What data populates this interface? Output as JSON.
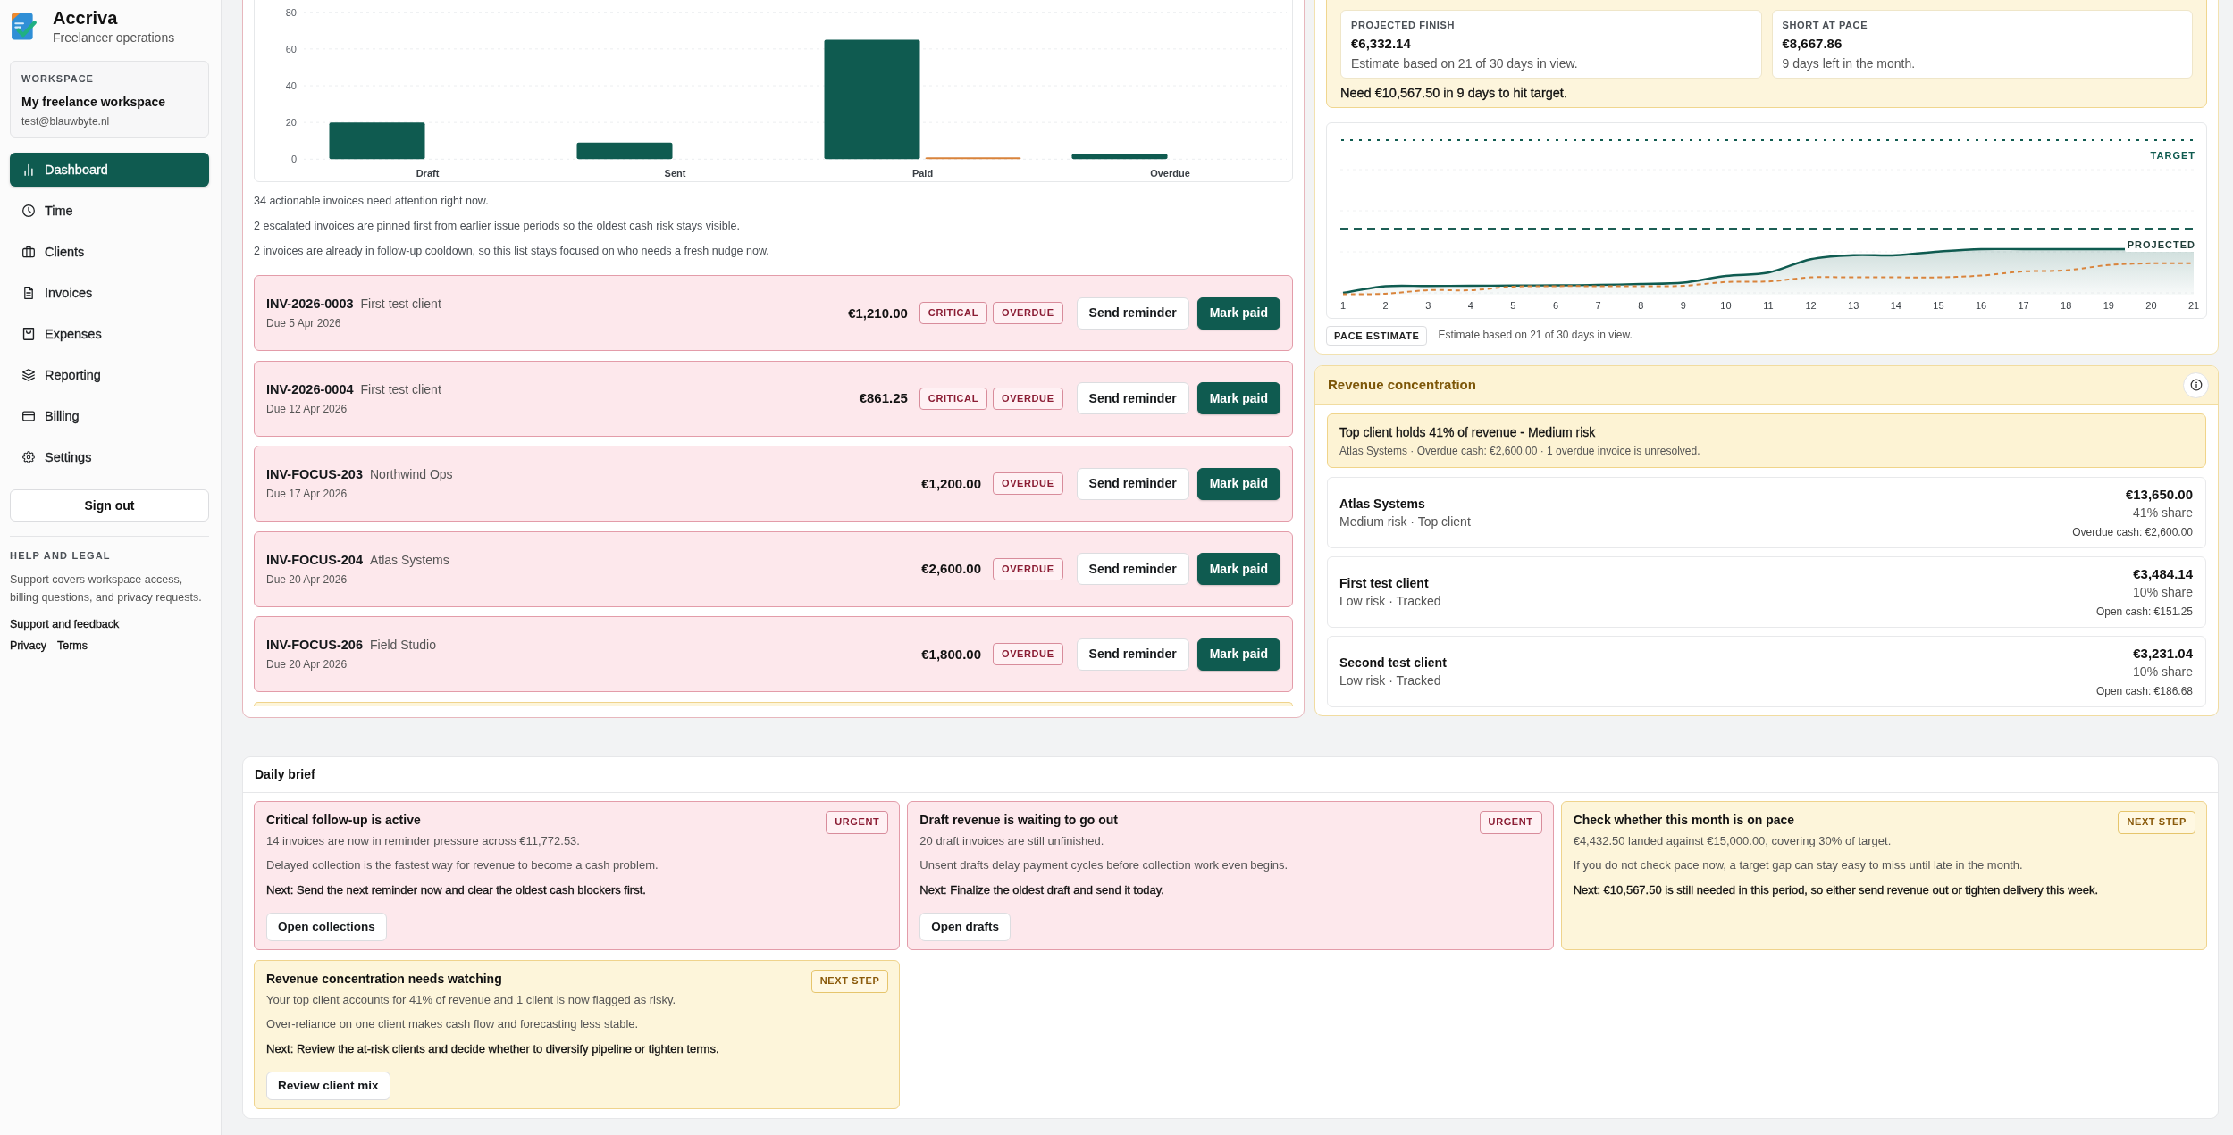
{
  "sidebar": {
    "brand": {
      "name": "Accriva",
      "tagline": "Freelancer operations"
    },
    "workspace": {
      "label": "WORKSPACE",
      "name": "My freelance workspace",
      "email": "test@blauwbyte.nl"
    },
    "nav": [
      {
        "label": "Dashboard",
        "selected": true
      },
      {
        "label": "Time",
        "selected": false
      },
      {
        "label": "Clients",
        "selected": false
      },
      {
        "label": "Invoices",
        "selected": false
      },
      {
        "label": "Expenses",
        "selected": false
      },
      {
        "label": "Reporting",
        "selected": false
      },
      {
        "label": "Billing",
        "selected": false
      },
      {
        "label": "Settings",
        "selected": false
      }
    ],
    "sign_out": "Sign out",
    "help": {
      "heading": "HELP AND LEGAL",
      "text": "Support covers workspace access, billing questions, and privacy requests.",
      "support_link": "Support and feedback",
      "legal_links": [
        "Privacy",
        "Terms"
      ]
    }
  },
  "invoice_panel": {
    "chart_data": {
      "type": "bar",
      "categories": [
        "Draft",
        "Sent",
        "Paid",
        "Overdue"
      ],
      "series": [
        {
          "color": "#0f5b50",
          "values": [
            20,
            9,
            65,
            3
          ]
        },
        {
          "color": "#d9843c",
          "values": [
            0,
            0,
            1,
            0
          ]
        }
      ],
      "ylim": [
        0,
        80
      ],
      "yticks": [
        0,
        20,
        40,
        60,
        80
      ],
      "grid": true
    },
    "notes": [
      "34 actionable invoices need attention right now.",
      "2 escalated invoices are pinned first from earlier issue periods so the oldest cash risk stays visible.",
      "2 invoices are already in follow-up cooldown, so this list stays focused on who needs a fresh nudge now."
    ],
    "invoices": [
      {
        "number": "INV-2026-0003",
        "client": "First test client",
        "due": "Due 5 Apr 2026",
        "amount": "€1,210.00",
        "badges": [
          "CRITICAL",
          "OVERDUE"
        ],
        "kind": "danger",
        "reminder_button": "Send reminder",
        "paid_button": "Mark paid"
      },
      {
        "number": "INV-2026-0004",
        "client": "First test client",
        "due": "Due 12 Apr 2026",
        "amount": "€861.25",
        "badges": [
          "CRITICAL",
          "OVERDUE"
        ],
        "kind": "danger",
        "reminder_button": "Send reminder",
        "paid_button": "Mark paid"
      },
      {
        "number": "INV-FOCUS-203",
        "client": "Northwind Ops",
        "due": "Due 17 Apr 2026",
        "amount": "€1,200.00",
        "badges": [
          "OVERDUE"
        ],
        "kind": "danger",
        "reminder_button": "Send reminder",
        "paid_button": "Mark paid"
      },
      {
        "number": "INV-FOCUS-204",
        "client": "Atlas Systems",
        "due": "Due 20 Apr 2026",
        "amount": "€2,600.00",
        "badges": [
          "OVERDUE"
        ],
        "kind": "danger",
        "reminder_button": "Send reminder",
        "paid_button": "Mark paid"
      },
      {
        "number": "INV-FOCUS-206",
        "client": "Field Studio",
        "due": "Due 20 Apr 2026",
        "amount": "€1,800.00",
        "badges": [
          "OVERDUE"
        ],
        "kind": "danger",
        "reminder_button": "Send reminder",
        "paid_button": "Mark paid"
      }
    ],
    "next_row": {
      "kind": "warning"
    }
  },
  "pace": {
    "tiles": [
      {
        "label": "PROJECTED FINISH",
        "value": "€6,332.14",
        "caption": "Estimate based on 21 of 30 days in view."
      },
      {
        "label": "SHORT AT PACE",
        "value": "€8,667.86",
        "caption": "9 days left in the month."
      }
    ],
    "need": "Need €10,567.50 in 9 days to hit target.",
    "chart": {
      "target_label": "TARGET",
      "projected_label": "PROJECTED",
      "x_labels": [
        "1",
        "2",
        "3",
        "4",
        "5",
        "6",
        "7",
        "8",
        "9",
        "10",
        "11",
        "12",
        "13",
        "14",
        "15",
        "16",
        "17",
        "18",
        "19",
        "20",
        "21"
      ]
    },
    "footer": {
      "tag": "PACE ESTIMATE",
      "text": "Estimate based on 21 of 30 days in view."
    }
  },
  "concentration": {
    "title": "Revenue concentration",
    "alert": {
      "title": "Top client holds 41% of revenue - Medium risk",
      "detail": "Atlas Systems · Overdue cash: €2,600.00 · 1 overdue invoice is unresolved."
    },
    "clients": [
      {
        "name": "Atlas Systems",
        "meta": "Medium risk · Top client",
        "amount": "€13,650.00",
        "share": "41% share",
        "cash": "Overdue cash: €2,600.00"
      },
      {
        "name": "First test client",
        "meta": "Low risk · Tracked",
        "amount": "€3,484.14",
        "share": "10% share",
        "cash": "Open cash: €151.25"
      },
      {
        "name": "Second test client",
        "meta": "Low risk · Tracked",
        "amount": "€3,231.04",
        "share": "10% share",
        "cash": "Open cash: €186.68"
      }
    ]
  },
  "daily_brief": {
    "title": "Daily brief",
    "items": [
      {
        "title": "Critical follow-up is active",
        "badge": "URGENT",
        "kind": "danger",
        "lines": [
          "14 invoices are now in reminder pressure across €11,772.53.",
          "Delayed collection is the fastest way for revenue to become a cash problem."
        ],
        "next": "Next: Send the next reminder now and clear the oldest cash blockers first.",
        "button": "Open collections"
      },
      {
        "title": "Draft revenue is waiting to go out",
        "badge": "URGENT",
        "kind": "danger",
        "lines": [
          "20 draft invoices are still unfinished.",
          "Unsent drafts delay payment cycles before collection work even begins."
        ],
        "next": "Next: Finalize the oldest draft and send it today.",
        "button": "Open drafts"
      },
      {
        "title": "Check whether this month is on pace",
        "badge": "NEXT STEP",
        "kind": "warning",
        "lines": [
          "€4,432.50 landed against €15,000.00, covering 30% of target.",
          "If you do not check pace now, a target gap can stay easy to miss until late in the month."
        ],
        "next": "Next: €10,567.50 is still needed in this period, so either send revenue out or tighten delivery this week."
      },
      {
        "title": "Revenue concentration needs watching",
        "badge": "NEXT STEP",
        "kind": "warning",
        "lines": [
          "Your top client accounts for 41% of revenue and 1 client is now flagged as risky.",
          "Over-reliance on one client makes cash flow and forecasting less stable."
        ],
        "next": "Next: Review the at-risk clients and decide whether to diversify pipeline or tighten terms.",
        "button": "Review client mix"
      }
    ]
  }
}
